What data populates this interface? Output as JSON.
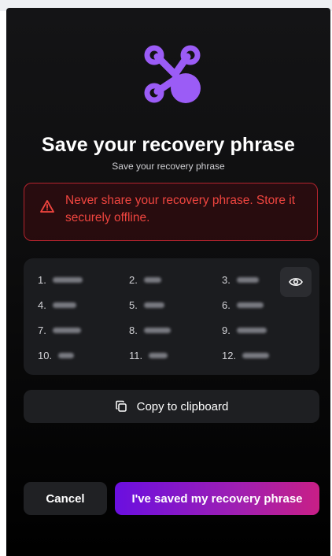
{
  "header": {
    "title": "Save your recovery phrase",
    "subtitle": "Save your recovery phrase",
    "logo_icon": "network-nodes-logo",
    "accent_color": "#9b5cf6"
  },
  "warning": {
    "icon": "warning-triangle-icon",
    "text": "Never share your recovery phrase. Store it securely offline.",
    "color": "#f0453f"
  },
  "phrase": {
    "words": [
      {
        "index": "1."
      },
      {
        "index": "2."
      },
      {
        "index": "3."
      },
      {
        "index": "4."
      },
      {
        "index": "5."
      },
      {
        "index": "6."
      },
      {
        "index": "7."
      },
      {
        "index": "8."
      },
      {
        "index": "9."
      },
      {
        "index": "10."
      },
      {
        "index": "11."
      },
      {
        "index": "12."
      }
    ],
    "reveal_icon": "eye-icon"
  },
  "actions": {
    "copy_label": "Copy to clipboard",
    "copy_icon": "copy-icon",
    "cancel_label": "Cancel",
    "confirm_label": "I've saved my recovery phrase"
  }
}
